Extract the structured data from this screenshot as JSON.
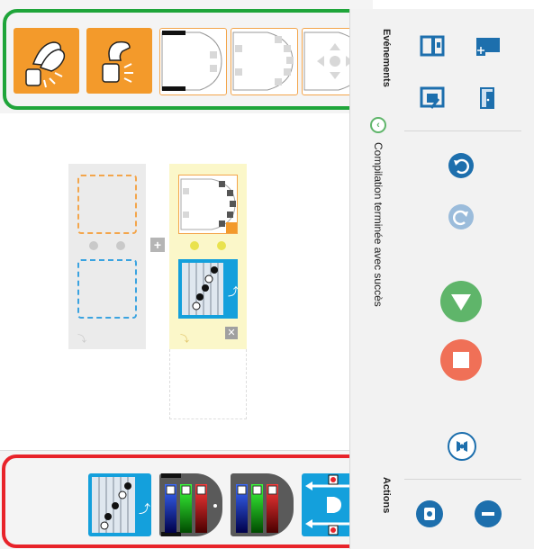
{
  "right_panel": {
    "events_label": "Evénements",
    "actions_label": "Actions",
    "compile_status": "Compilation terminée avec succès"
  },
  "events": [
    {
      "id": "clap",
      "icon": "hand-clap-icon",
      "style": "orange"
    },
    {
      "id": "tap",
      "icon": "robot-tap-icon",
      "style": "orange"
    },
    {
      "id": "ground",
      "icon": "ground-sensors-icon",
      "style": "white"
    },
    {
      "id": "proximity",
      "icon": "proximity-sensors-icon",
      "style": "white"
    },
    {
      "id": "buttons",
      "icon": "arrow-buttons-icon",
      "style": "white"
    }
  ],
  "actions": [
    {
      "id": "music",
      "icon": "music-notes-icon"
    },
    {
      "id": "top-color",
      "icon": "top-color-icon"
    },
    {
      "id": "bottom-color",
      "icon": "bottom-color-icon"
    },
    {
      "id": "motors",
      "icon": "motors-icon"
    }
  ],
  "colors": {
    "events_frame": "#1fa53a",
    "actions_frame": "#e8232a",
    "event_orange": "#f39a2b",
    "action_blue": "#14a0dc",
    "accent_blue": "#1d6fad",
    "go_green": "#5fb56a",
    "stop_red": "#f07057"
  }
}
